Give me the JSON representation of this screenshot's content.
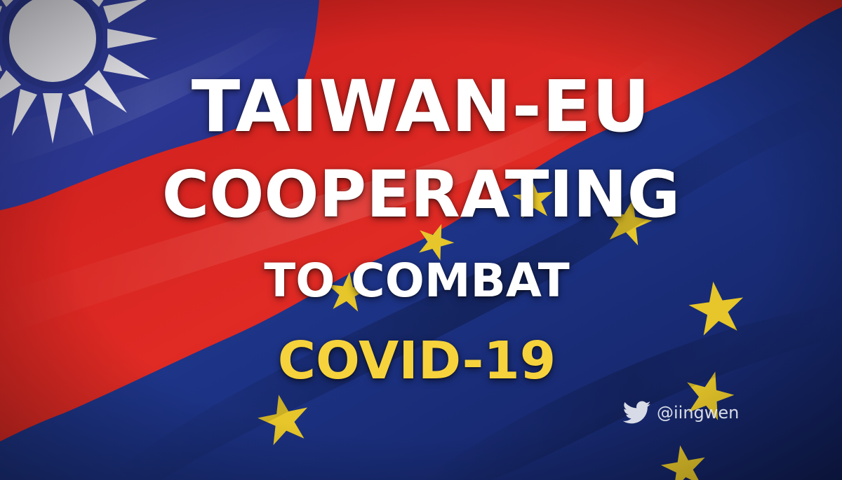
{
  "image": {
    "headline": {
      "line1": "TAIWAN-EU",
      "line2": "COOPERATING",
      "line3": "TO COMBAT",
      "line4": "COVID-19"
    },
    "credit": {
      "icon": "twitter-bird-icon",
      "handle": "@iingwen"
    },
    "colors": {
      "taiwan_red": "#d9221f",
      "taiwan_blue": "#2d3a96",
      "taiwan_sun": "#e9e9f0",
      "eu_blue": "#1e3587",
      "eu_star": "#e6c62a",
      "text_white": "#ffffff",
      "text_yellow": "#f6d33c"
    }
  }
}
